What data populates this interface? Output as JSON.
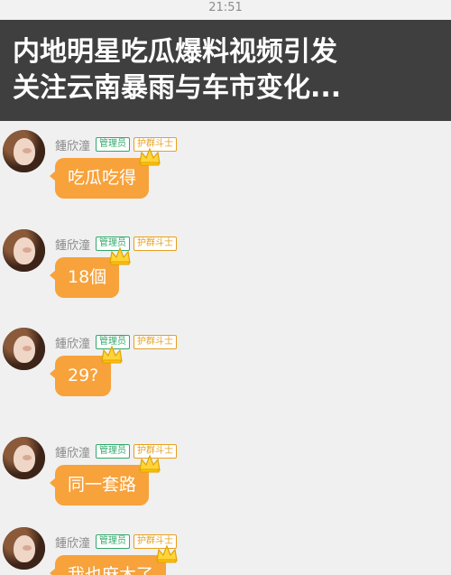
{
  "status_bar": {
    "time": "21:51"
  },
  "headline": {
    "line1": "内地明星吃瓜爆料视频引发",
    "line2": "关注云南暴雨与车市变化..."
  },
  "messages": [
    {
      "user": "鍾欣潼",
      "badge_admin": "管理员",
      "badge_fighter": "护群斗士",
      "text": "吃瓜吃得"
    },
    {
      "user": "鍾欣潼",
      "badge_admin": "管理员",
      "badge_fighter": "护群斗士",
      "text": "18個"
    },
    {
      "user": "鍾欣潼",
      "badge_admin": "管理员",
      "badge_fighter": "护群斗士",
      "text": "29?"
    },
    {
      "user": "鍾欣潼",
      "badge_admin": "管理员",
      "badge_fighter": "护群斗士",
      "text": "同一套路"
    },
    {
      "user": "鍾欣潼",
      "badge_admin": "管理员",
      "badge_fighter": "护群斗士",
      "text": "我也麻木了"
    }
  ],
  "colors": {
    "bubble": "#f7a23b",
    "admin_badge": "#32a86b",
    "fighter_badge": "#e6a020",
    "headline_bg": "#3f3f3f",
    "chat_bg": "#f0f0f0"
  }
}
